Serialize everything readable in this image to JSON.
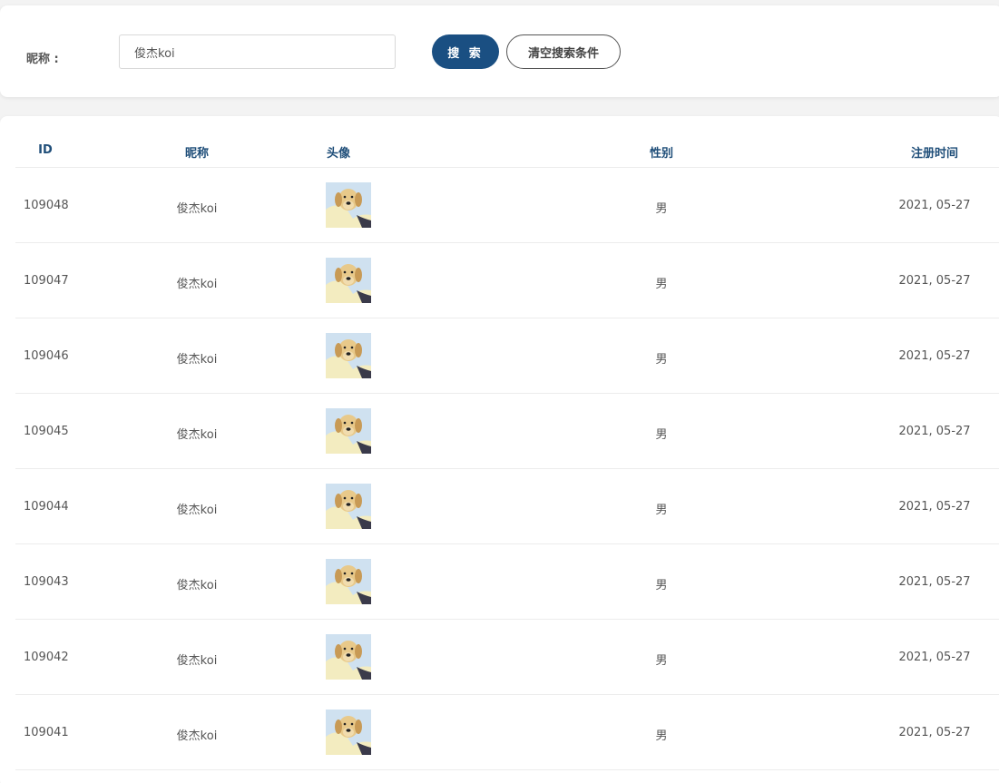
{
  "search": {
    "label": "昵称 :",
    "value": "俊杰koi",
    "search_button": "搜 索",
    "clear_button": "清空搜索条件"
  },
  "table": {
    "columns": [
      "ID",
      "昵称",
      "头像",
      "性别",
      "注册时间"
    ],
    "rows": [
      {
        "id": "109048",
        "nickname": "俊杰koi",
        "avatar": "dog-avatar-icon",
        "gender": "男",
        "registered": "2021, 05-27"
      },
      {
        "id": "109047",
        "nickname": "俊杰koi",
        "avatar": "dog-avatar-icon",
        "gender": "男",
        "registered": "2021, 05-27"
      },
      {
        "id": "109046",
        "nickname": "俊杰koi",
        "avatar": "dog-avatar-icon",
        "gender": "男",
        "registered": "2021, 05-27"
      },
      {
        "id": "109045",
        "nickname": "俊杰koi",
        "avatar": "dog-avatar-icon",
        "gender": "男",
        "registered": "2021, 05-27"
      },
      {
        "id": "109044",
        "nickname": "俊杰koi",
        "avatar": "dog-avatar-icon",
        "gender": "男",
        "registered": "2021, 05-27"
      },
      {
        "id": "109043",
        "nickname": "俊杰koi",
        "avatar": "dog-avatar-icon",
        "gender": "男",
        "registered": "2021, 05-27"
      },
      {
        "id": "109042",
        "nickname": "俊杰koi",
        "avatar": "dog-avatar-icon",
        "gender": "男",
        "registered": "2021, 05-27"
      },
      {
        "id": "109041",
        "nickname": "俊杰koi",
        "avatar": "dog-avatar-icon",
        "gender": "男",
        "registered": "2021, 05-27"
      }
    ]
  },
  "colors": {
    "primary": "#1a4f82",
    "header_text": "#1f4e79",
    "body_text": "#555555",
    "background": "#f3f3f3"
  }
}
